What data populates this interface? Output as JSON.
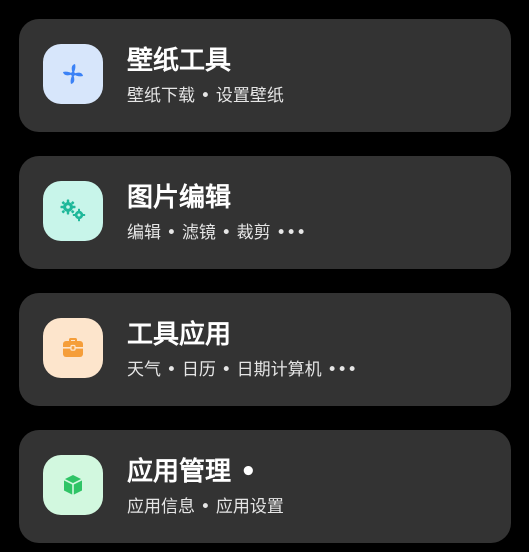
{
  "cards": [
    {
      "title": "壁纸工具",
      "subtitle": "壁纸下载 • 设置壁纸",
      "icon": "pinwheel-icon",
      "icon_bg": "#d7e6fb",
      "icon_color": "#3b82f6"
    },
    {
      "title": "图片编辑",
      "subtitle": "编辑 • 滤镜 • 裁剪 •••",
      "icon": "gears-icon",
      "icon_bg": "#c8f5ea",
      "icon_color": "#1fb89a"
    },
    {
      "title": "工具应用",
      "subtitle": "天气 • 日历 • 日期计算机 •••",
      "icon": "toolbox-icon",
      "icon_bg": "#fde5cc",
      "icon_color": "#f59e3a"
    },
    {
      "title": "应用管理 •",
      "subtitle": "应用信息 • 应用设置",
      "icon": "cube-icon",
      "icon_bg": "#d2f8df",
      "icon_color": "#2fc466"
    }
  ]
}
